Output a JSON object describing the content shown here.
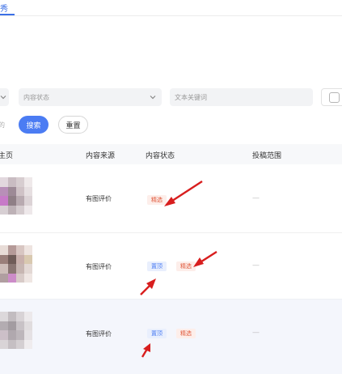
{
  "tabs": {
    "active_label": "秀"
  },
  "filters": {
    "status_placeholder": "内容状态",
    "keyword_placeholder": "文本关键词"
  },
  "actions": {
    "cut_text": "的",
    "search_label": "搜索",
    "reset_label": "重置"
  },
  "table": {
    "headers": {
      "col1": "主页",
      "source": "内容来源",
      "status": "内容状态",
      "range": "投稿范围"
    },
    "rows": [
      {
        "source": "有图评价",
        "tags": [
          "精选"
        ],
        "range": "—"
      },
      {
        "source": "有图评价",
        "tags": [
          "置顶",
          "精选"
        ],
        "range": "—"
      },
      {
        "source": "有图评价",
        "tags": [
          "置顶",
          "精选"
        ],
        "range": "—"
      }
    ]
  },
  "colors": {
    "accent": "#4b7cf3",
    "featured_tag_text": "#e0583b",
    "featured_tag_bg": "#fdeeea",
    "pinned_tag_bg": "#e9effd",
    "annotation_arrow": "#d81e1e"
  },
  "icons": [
    "chevron-down-icon",
    "red-arrow-annotation"
  ]
}
